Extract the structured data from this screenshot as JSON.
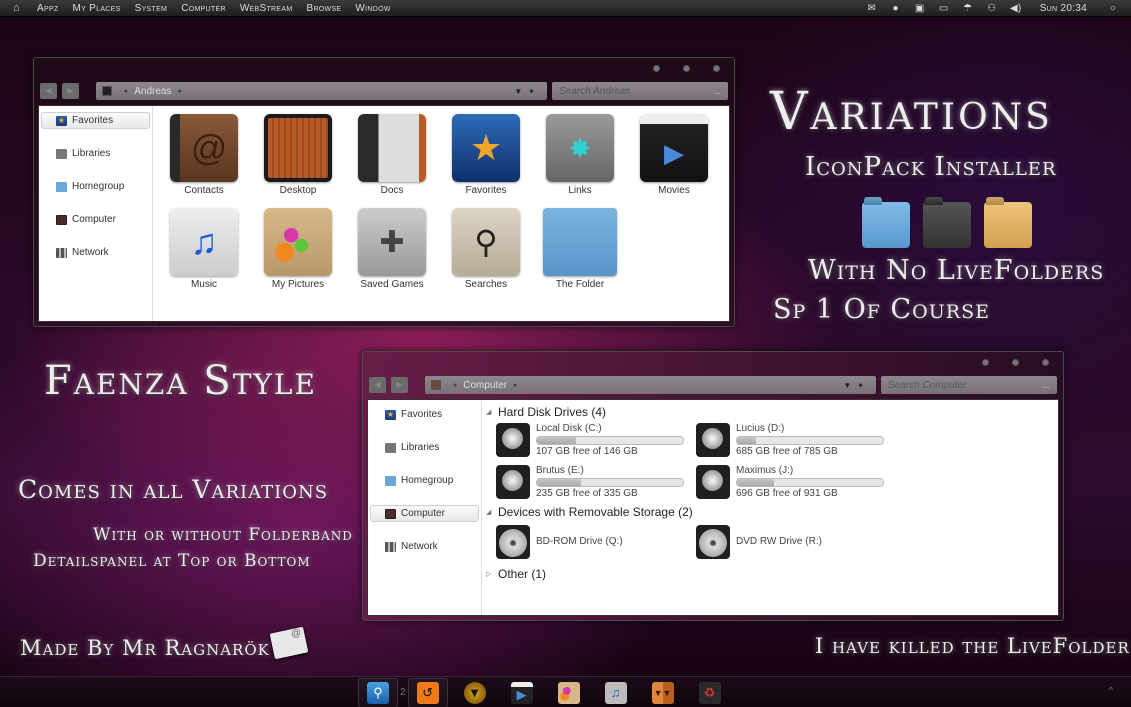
{
  "menubar": {
    "home_icon": "home-icon",
    "items": [
      "Appz",
      "My Places",
      "System",
      "Computer",
      "WebStream",
      "Browse",
      "Window"
    ],
    "tray_icons": [
      "mail-icon",
      "chat-icon",
      "lock-icon",
      "monitor-icon",
      "weather-icon",
      "users-icon",
      "volume-icon"
    ],
    "clock": "Sun 20:34",
    "search_icon": "search-icon"
  },
  "window1": {
    "address": "Andreas",
    "search_placeholder": "Search Andreas",
    "sidebar": [
      {
        "label": "Favorites",
        "icon": "star-icon",
        "selected": true
      },
      {
        "label": "Libraries",
        "icon": "library-icon",
        "selected": false
      },
      {
        "label": "Homegroup",
        "icon": "folder-icon",
        "selected": false
      },
      {
        "label": "Computer",
        "icon": "computer-icon",
        "selected": false
      },
      {
        "label": "Network",
        "icon": "network-icon",
        "selected": false
      }
    ],
    "items": [
      {
        "label": "Contacts",
        "icon": "contacts-icon"
      },
      {
        "label": "Desktop",
        "icon": "desktop-icon"
      },
      {
        "label": "Docs",
        "icon": "docs-icon"
      },
      {
        "label": "Favorites",
        "icon": "favorites-star-icon"
      },
      {
        "label": "Links",
        "icon": "links-globe-icon"
      },
      {
        "label": "Movies",
        "icon": "movies-clapper-icon"
      },
      {
        "label": "Music",
        "icon": "music-icon"
      },
      {
        "label": "My Pictures",
        "icon": "pictures-paint-icon"
      },
      {
        "label": "Saved Games",
        "icon": "gamepad-icon"
      },
      {
        "label": "Searches",
        "icon": "magnifier-icon"
      },
      {
        "label": "The Folder",
        "icon": "blue-folder-icon"
      }
    ]
  },
  "window2": {
    "address": "Computer",
    "search_placeholder": "Search Computer",
    "sidebar": [
      {
        "label": "Favorites",
        "selected": false
      },
      {
        "label": "Libraries",
        "selected": false
      },
      {
        "label": "Homegroup",
        "selected": false
      },
      {
        "label": "Computer",
        "selected": true
      },
      {
        "label": "Network",
        "selected": false
      }
    ],
    "groups": {
      "hdd": "Hard Disk Drives (4)",
      "removable": "Devices with Removable Storage (2)",
      "other": "Other (1)"
    },
    "drives": [
      {
        "name": "Local Disk (C:)",
        "status": "107 GB free of 146 GB",
        "used_fraction": 0.27
      },
      {
        "name": "Lucius (D:)",
        "status": "685 GB free of 785 GB",
        "used_fraction": 0.13
      },
      {
        "name": "Brutus (E:)",
        "status": "235 GB free of 335 GB",
        "used_fraction": 0.3
      },
      {
        "name": "Maximus (J:)",
        "status": "696 GB free of 931 GB",
        "used_fraction": 0.25
      }
    ],
    "removable": [
      {
        "name": "BD-ROM Drive (Q:)"
      },
      {
        "name": "DVD RW Drive (R:)"
      }
    ]
  },
  "promo": {
    "title": "Variations",
    "subtitle": "IconPack Installer",
    "folders": [
      {
        "name": "blue",
        "color": "#6aa7d6"
      },
      {
        "name": "dark",
        "color": "#4a4a4a"
      },
      {
        "name": "tan",
        "color": "#e2b468"
      }
    ],
    "line1": "With No LiveFolders",
    "line2": "Sp 1 Of Course",
    "faenza": "Faenza Style",
    "comes": "Comes in all Variations",
    "folderband": "With or without Folderband",
    "detailspanel": "Detailspanel at Top or Bottom",
    "made_by": "Made By Mr Ragnarök",
    "killed": "I have killed the LiveFolder"
  },
  "dock": {
    "badge": "2",
    "items": [
      "finder-search-icon",
      "undo-app-icon",
      "batman-app-icon",
      "movie-clapper-icon",
      "paint-app-icon",
      "itunes-icon",
      "archive-app-icon",
      "recycle-bin-icon"
    ],
    "tray_arrow": "^"
  }
}
